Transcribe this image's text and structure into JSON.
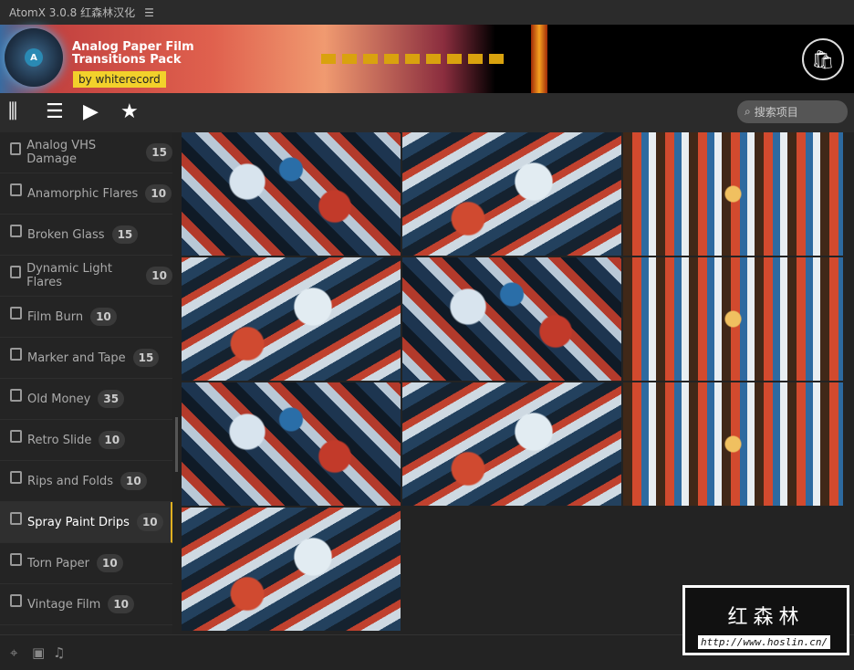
{
  "app": {
    "title": "AtomX 3.0.8 红森林汉化",
    "menu_icon": "hamburger-icon"
  },
  "banner": {
    "title_line1": "Analog Paper Film",
    "title_line2": "Transitions Pack",
    "author": "by whiterecord",
    "logo_letter": "A"
  },
  "toolbar": {
    "search_placeholder": "搜索项目"
  },
  "sidebar": {
    "items": [
      {
        "label": "Analog VHS Damage",
        "count": "15"
      },
      {
        "label": "Anamorphic Flares",
        "count": "10"
      },
      {
        "label": "Broken Glass",
        "count": "15"
      },
      {
        "label": "Dynamic Light Flares",
        "count": "10"
      },
      {
        "label": "Film Burn",
        "count": "10"
      },
      {
        "label": "Marker and Tape",
        "count": "15"
      },
      {
        "label": "Old Money",
        "count": "35"
      },
      {
        "label": "Retro Slide",
        "count": "10"
      },
      {
        "label": "Rips and Folds",
        "count": "10"
      },
      {
        "label": "Spray Paint Drips",
        "count": "10",
        "active": true
      },
      {
        "label": "Torn Paper",
        "count": "10"
      },
      {
        "label": "Vintage Film",
        "count": "10"
      }
    ]
  },
  "thumbnails_count": 10,
  "watermark": {
    "name": "红森林",
    "url": "http://www.hoslin.cn/"
  },
  "colors": {
    "accent": "#e0b020",
    "badge_bg": "#3a3a3a"
  }
}
